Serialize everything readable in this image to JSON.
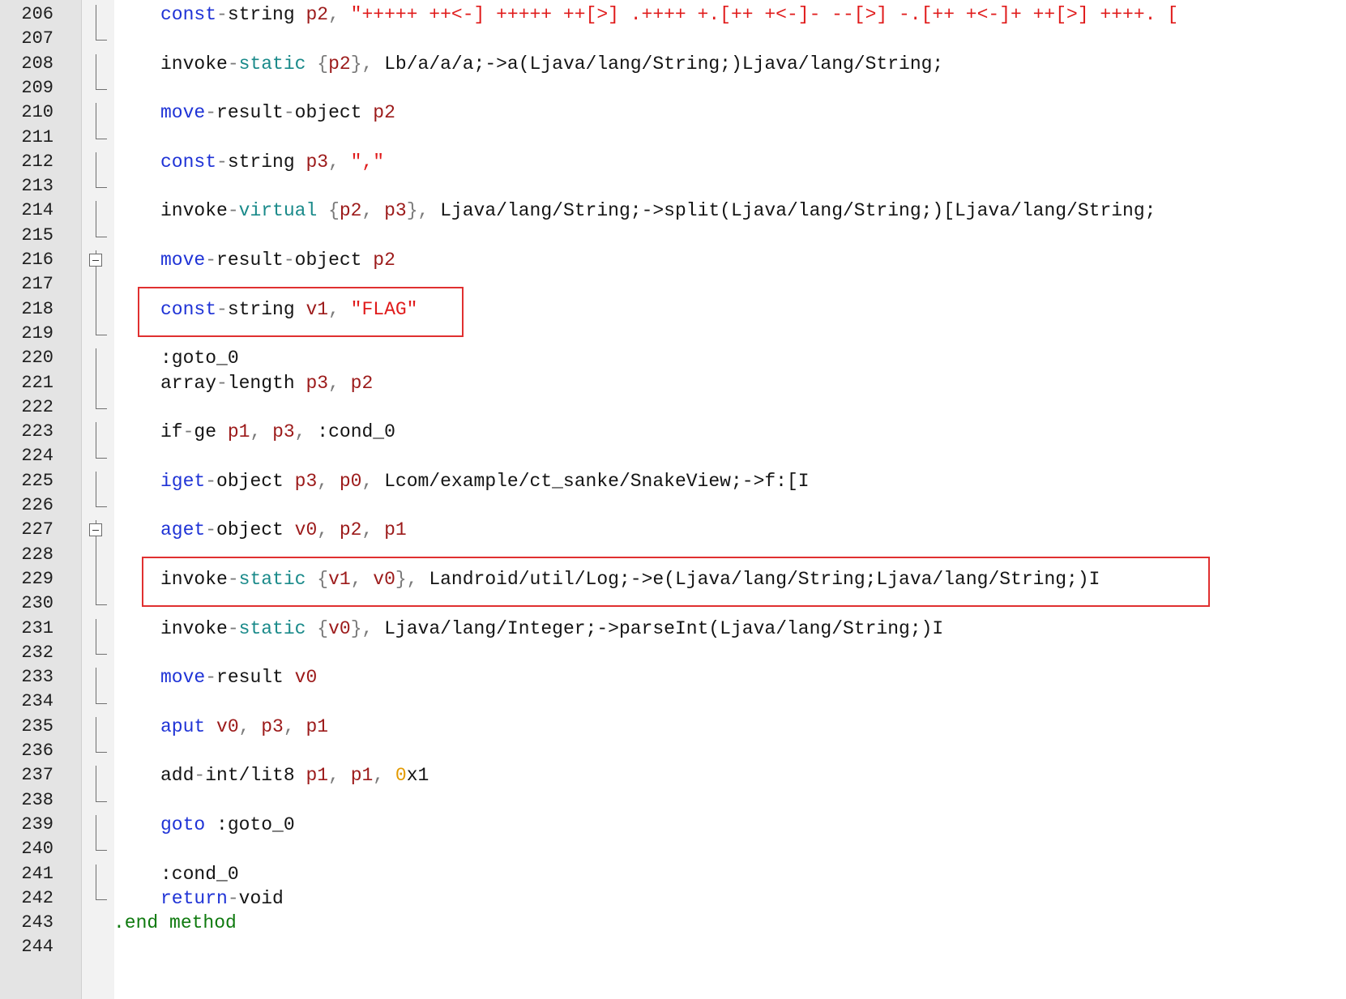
{
  "editor": {
    "accent_highlight_color": "#e03030",
    "lines": [
      {
        "number": "206",
        "indent": 1,
        "tokens": [
          {
            "t": "const",
            "c": "kw"
          },
          {
            "t": "-",
            "c": "op"
          },
          {
            "t": "string ",
            "c": "type"
          },
          {
            "t": "p2",
            "c": "reg"
          },
          {
            "t": ", ",
            "c": "op"
          },
          {
            "t": "\"+++++ ++<-] +++++ ++[>] .++++ +.[++ +<-]- --[>] -.[++ +<-]+ ++[>] ++++. [",
            "c": "str"
          }
        ]
      },
      {
        "number": "207",
        "indent": 1,
        "tokens": []
      },
      {
        "number": "208",
        "indent": 1,
        "tokens": [
          {
            "t": "invoke",
            "c": "type"
          },
          {
            "t": "-",
            "c": "op"
          },
          {
            "t": "static",
            "c": "kw2"
          },
          {
            "t": " {",
            "c": "op"
          },
          {
            "t": "p2",
            "c": "reg"
          },
          {
            "t": "}, ",
            "c": "op"
          },
          {
            "t": "Lb/a/a/a;->a(Ljava/lang/String;)Ljava/lang/String;",
            "c": "type"
          }
        ]
      },
      {
        "number": "209",
        "indent": 1,
        "tokens": []
      },
      {
        "number": "210",
        "indent": 1,
        "tokens": [
          {
            "t": "move",
            "c": "kw"
          },
          {
            "t": "-",
            "c": "op"
          },
          {
            "t": "result",
            "c": "type"
          },
          {
            "t": "-",
            "c": "op"
          },
          {
            "t": "object ",
            "c": "type"
          },
          {
            "t": "p2",
            "c": "reg"
          }
        ]
      },
      {
        "number": "211",
        "indent": 1,
        "tokens": []
      },
      {
        "number": "212",
        "indent": 1,
        "tokens": [
          {
            "t": "const",
            "c": "kw"
          },
          {
            "t": "-",
            "c": "op"
          },
          {
            "t": "string ",
            "c": "type"
          },
          {
            "t": "p3",
            "c": "reg"
          },
          {
            "t": ", ",
            "c": "op"
          },
          {
            "t": "\",\"",
            "c": "str"
          }
        ]
      },
      {
        "number": "213",
        "indent": 1,
        "tokens": []
      },
      {
        "number": "214",
        "indent": 1,
        "tokens": [
          {
            "t": "invoke",
            "c": "type"
          },
          {
            "t": "-",
            "c": "op"
          },
          {
            "t": "virtual",
            "c": "kw2"
          },
          {
            "t": " {",
            "c": "op"
          },
          {
            "t": "p2",
            "c": "reg"
          },
          {
            "t": ", ",
            "c": "op"
          },
          {
            "t": "p3",
            "c": "reg"
          },
          {
            "t": "}, ",
            "c": "op"
          },
          {
            "t": "Ljava/lang/String;->split(Ljava/lang/String;)[Ljava/lang/String;",
            "c": "type"
          }
        ]
      },
      {
        "number": "215",
        "indent": 1,
        "tokens": []
      },
      {
        "number": "216",
        "indent": 1,
        "tokens": [
          {
            "t": "move",
            "c": "kw"
          },
          {
            "t": "-",
            "c": "op"
          },
          {
            "t": "result",
            "c": "type"
          },
          {
            "t": "-",
            "c": "op"
          },
          {
            "t": "object ",
            "c": "type"
          },
          {
            "t": "p2",
            "c": "reg"
          }
        ]
      },
      {
        "number": "217",
        "indent": 1,
        "tokens": []
      },
      {
        "number": "218",
        "indent": 1,
        "tokens": [
          {
            "t": "const",
            "c": "kw"
          },
          {
            "t": "-",
            "c": "op"
          },
          {
            "t": "string ",
            "c": "type"
          },
          {
            "t": "v1",
            "c": "reg"
          },
          {
            "t": ", ",
            "c": "op"
          },
          {
            "t": "\"FLAG\"",
            "c": "str"
          }
        ]
      },
      {
        "number": "219",
        "indent": 1,
        "tokens": []
      },
      {
        "number": "220",
        "indent": 1,
        "tokens": [
          {
            "t": ":goto_0",
            "c": "lbl"
          }
        ]
      },
      {
        "number": "221",
        "indent": 1,
        "tokens": [
          {
            "t": "array",
            "c": "type"
          },
          {
            "t": "-",
            "c": "op"
          },
          {
            "t": "length ",
            "c": "type"
          },
          {
            "t": "p3",
            "c": "reg"
          },
          {
            "t": ", ",
            "c": "op"
          },
          {
            "t": "p2",
            "c": "reg"
          }
        ]
      },
      {
        "number": "222",
        "indent": 1,
        "tokens": []
      },
      {
        "number": "223",
        "indent": 1,
        "tokens": [
          {
            "t": "if",
            "c": "type"
          },
          {
            "t": "-",
            "c": "op"
          },
          {
            "t": "ge ",
            "c": "type"
          },
          {
            "t": "p1",
            "c": "reg"
          },
          {
            "t": ", ",
            "c": "op"
          },
          {
            "t": "p3",
            "c": "reg"
          },
          {
            "t": ", ",
            "c": "op"
          },
          {
            "t": ":cond_0",
            "c": "lbl"
          }
        ]
      },
      {
        "number": "224",
        "indent": 1,
        "tokens": []
      },
      {
        "number": "225",
        "indent": 1,
        "tokens": [
          {
            "t": "iget",
            "c": "kw"
          },
          {
            "t": "-",
            "c": "op"
          },
          {
            "t": "object ",
            "c": "type"
          },
          {
            "t": "p3",
            "c": "reg"
          },
          {
            "t": ", ",
            "c": "op"
          },
          {
            "t": "p0",
            "c": "reg"
          },
          {
            "t": ", ",
            "c": "op"
          },
          {
            "t": "Lcom/example/ct_sanke/SnakeView;->f:[I",
            "c": "type"
          }
        ]
      },
      {
        "number": "226",
        "indent": 1,
        "tokens": []
      },
      {
        "number": "227",
        "indent": 1,
        "tokens": [
          {
            "t": "aget",
            "c": "kw"
          },
          {
            "t": "-",
            "c": "op"
          },
          {
            "t": "object ",
            "c": "type"
          },
          {
            "t": "v0",
            "c": "reg"
          },
          {
            "t": ", ",
            "c": "op"
          },
          {
            "t": "p2",
            "c": "reg"
          },
          {
            "t": ", ",
            "c": "op"
          },
          {
            "t": "p1",
            "c": "reg"
          }
        ]
      },
      {
        "number": "228",
        "indent": 1,
        "tokens": []
      },
      {
        "number": "229",
        "indent": 1,
        "tokens": [
          {
            "t": "invoke",
            "c": "type"
          },
          {
            "t": "-",
            "c": "op"
          },
          {
            "t": "static",
            "c": "kw2"
          },
          {
            "t": " {",
            "c": "op"
          },
          {
            "t": "v1",
            "c": "reg"
          },
          {
            "t": ", ",
            "c": "op"
          },
          {
            "t": "v0",
            "c": "reg"
          },
          {
            "t": "}, ",
            "c": "op"
          },
          {
            "t": "Landroid/util/Log;->e(Ljava/lang/String;Ljava/lang/String;)I",
            "c": "type"
          }
        ]
      },
      {
        "number": "230",
        "indent": 1,
        "tokens": []
      },
      {
        "number": "231",
        "indent": 1,
        "tokens": [
          {
            "t": "invoke",
            "c": "type"
          },
          {
            "t": "-",
            "c": "op"
          },
          {
            "t": "static",
            "c": "kw2"
          },
          {
            "t": " {",
            "c": "op"
          },
          {
            "t": "v0",
            "c": "reg"
          },
          {
            "t": "}, ",
            "c": "op"
          },
          {
            "t": "Ljava/lang/Integer;->parseInt(Ljava/lang/String;)I",
            "c": "type"
          }
        ]
      },
      {
        "number": "232",
        "indent": 1,
        "tokens": []
      },
      {
        "number": "233",
        "indent": 1,
        "tokens": [
          {
            "t": "move",
            "c": "kw"
          },
          {
            "t": "-",
            "c": "op"
          },
          {
            "t": "result ",
            "c": "type"
          },
          {
            "t": "v0",
            "c": "reg"
          }
        ]
      },
      {
        "number": "234",
        "indent": 1,
        "tokens": []
      },
      {
        "number": "235",
        "indent": 1,
        "tokens": [
          {
            "t": "aput ",
            "c": "kw"
          },
          {
            "t": "v0",
            "c": "reg"
          },
          {
            "t": ", ",
            "c": "op"
          },
          {
            "t": "p3",
            "c": "reg"
          },
          {
            "t": ", ",
            "c": "op"
          },
          {
            "t": "p1",
            "c": "reg"
          }
        ]
      },
      {
        "number": "236",
        "indent": 1,
        "tokens": []
      },
      {
        "number": "237",
        "indent": 1,
        "tokens": [
          {
            "t": "add",
            "c": "type"
          },
          {
            "t": "-",
            "c": "op"
          },
          {
            "t": "int/lit8 ",
            "c": "type"
          },
          {
            "t": "p1",
            "c": "reg"
          },
          {
            "t": ", ",
            "c": "op"
          },
          {
            "t": "p1",
            "c": "reg"
          },
          {
            "t": ", ",
            "c": "op"
          },
          {
            "t": "0",
            "c": "num"
          },
          {
            "t": "x1",
            "c": "type"
          }
        ]
      },
      {
        "number": "238",
        "indent": 1,
        "tokens": []
      },
      {
        "number": "239",
        "indent": 1,
        "tokens": [
          {
            "t": "goto ",
            "c": "kw"
          },
          {
            "t": ":goto_0",
            "c": "lbl"
          }
        ]
      },
      {
        "number": "240",
        "indent": 1,
        "tokens": []
      },
      {
        "number": "241",
        "indent": 1,
        "tokens": [
          {
            "t": ":cond_0",
            "c": "lbl"
          }
        ]
      },
      {
        "number": "242",
        "indent": 1,
        "tokens": [
          {
            "t": "return",
            "c": "kw"
          },
          {
            "t": "-",
            "c": "op"
          },
          {
            "t": "void",
            "c": "type"
          }
        ]
      },
      {
        "number": "243",
        "indent": 0,
        "tokens": [
          {
            "t": ".end method",
            "c": "dir"
          }
        ]
      },
      {
        "number": "244",
        "indent": 0,
        "tokens": []
      }
    ],
    "highlights": [
      {
        "label": "highlight-box-const-flag",
        "line_index": 12
      },
      {
        "label": "highlight-box-log-call",
        "line_index": 23
      }
    ]
  }
}
